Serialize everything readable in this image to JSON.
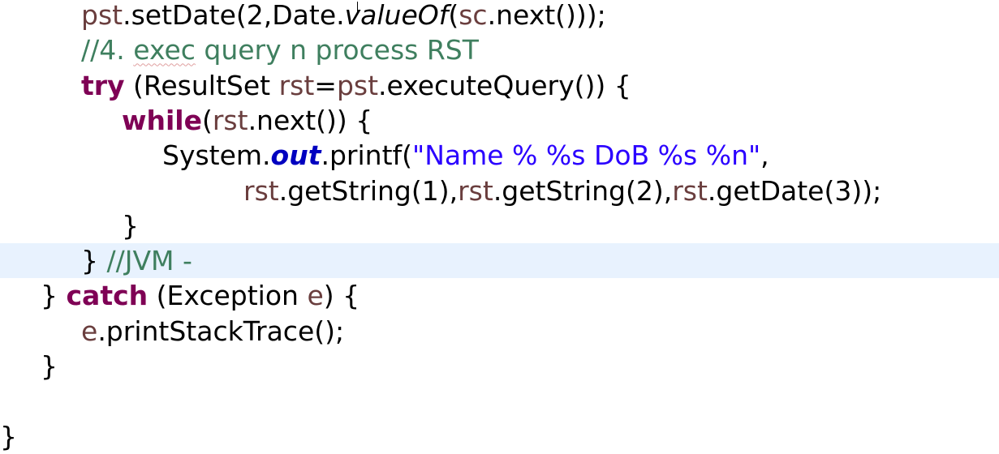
{
  "editor": {
    "lines": [
      {
        "name": "code-line-setdate",
        "highlight": false,
        "indent": 100,
        "tokens": [
          {
            "t": "pst",
            "c": "var"
          },
          {
            "t": ".setDate(2,Date.",
            "c": ""
          },
          {
            "t": "valueOf",
            "c": "smi"
          },
          {
            "t": "(",
            "c": ""
          },
          {
            "t": "sc",
            "c": "var"
          },
          {
            "t": ".next()));",
            "c": ""
          }
        ]
      },
      {
        "name": "code-line-comment-exec-query",
        "highlight": false,
        "indent": 100,
        "tokens": [
          {
            "t": "//4. ",
            "c": "cm"
          },
          {
            "t": "exec",
            "c": "cm sp"
          },
          {
            "t": " query n process RST",
            "c": "cm"
          }
        ]
      },
      {
        "name": "code-line-try",
        "highlight": false,
        "indent": 100,
        "tokens": [
          {
            "t": "try",
            "c": "kw"
          },
          {
            "t": " (ResultSet ",
            "c": ""
          },
          {
            "t": "rst",
            "c": "var"
          },
          {
            "t": "=",
            "c": ""
          },
          {
            "t": "pst",
            "c": "var"
          },
          {
            "t": ".executeQuery()) {",
            "c": ""
          }
        ]
      },
      {
        "name": "code-line-while",
        "highlight": false,
        "indent": 150,
        "tokens": [
          {
            "t": "while",
            "c": "kw"
          },
          {
            "t": "(",
            "c": ""
          },
          {
            "t": "rst",
            "c": "var"
          },
          {
            "t": ".next()) {",
            "c": ""
          }
        ]
      },
      {
        "name": "code-line-printf",
        "highlight": false,
        "indent": 200,
        "tokens": [
          {
            "t": "System.",
            "c": ""
          },
          {
            "t": "out",
            "c": "fld"
          },
          {
            "t": ".printf(",
            "c": ""
          },
          {
            "t": "\"Name % %s DoB %s %n\"",
            "c": "st"
          },
          {
            "t": ",",
            "c": ""
          }
        ]
      },
      {
        "name": "code-line-printf-args",
        "highlight": false,
        "indent": 300,
        "tokens": [
          {
            "t": "rst",
            "c": "var"
          },
          {
            "t": ".getString(1),",
            "c": ""
          },
          {
            "t": "rst",
            "c": "var"
          },
          {
            "t": ".getString(2),",
            "c": ""
          },
          {
            "t": "rst",
            "c": "var"
          },
          {
            "t": ".getDate(3));",
            "c": ""
          }
        ]
      },
      {
        "name": "code-line-close-while",
        "highlight": false,
        "indent": 150,
        "tokens": [
          {
            "t": "}",
            "c": ""
          }
        ]
      },
      {
        "name": "code-line-close-try",
        "highlight": true,
        "indent": 100,
        "tokens": [
          {
            "t": "} ",
            "c": ""
          },
          {
            "t": "//JVM -",
            "c": "cm"
          }
        ]
      },
      {
        "name": "code-line-catch",
        "highlight": false,
        "indent": 50,
        "tokens": [
          {
            "t": "} ",
            "c": ""
          },
          {
            "t": "catch",
            "c": "kw"
          },
          {
            "t": " (Exception ",
            "c": ""
          },
          {
            "t": "e",
            "c": "var"
          },
          {
            "t": ") {",
            "c": ""
          }
        ]
      },
      {
        "name": "code-line-printstacktrace",
        "highlight": false,
        "indent": 100,
        "tokens": [
          {
            "t": "e",
            "c": "var"
          },
          {
            "t": ".printStackTrace();",
            "c": ""
          }
        ]
      },
      {
        "name": "code-line-close-catch",
        "highlight": false,
        "indent": 50,
        "tokens": [
          {
            "t": "}",
            "c": ""
          }
        ]
      },
      {
        "name": "code-line-blank",
        "highlight": false,
        "indent": 0,
        "tokens": []
      },
      {
        "name": "code-line-close-method",
        "highlight": false,
        "indent": 0,
        "tokens": [
          {
            "t": "}",
            "c": ""
          }
        ]
      }
    ]
  }
}
